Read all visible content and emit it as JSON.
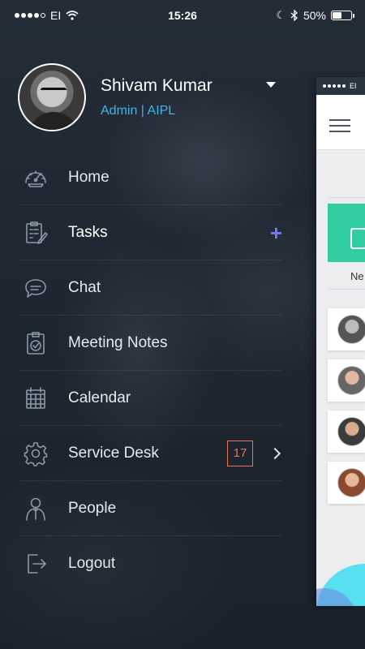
{
  "status_bar": {
    "carrier": "EI",
    "time": "15:26",
    "battery": "50%"
  },
  "profile": {
    "name": "Shivam Kumar",
    "role": "Admin | AIPL"
  },
  "menu": {
    "items": [
      {
        "label": "Home",
        "icon": "dashboard-gauge-icon"
      },
      {
        "label": "Tasks",
        "icon": "clipboard-pencil-icon",
        "action": "+"
      },
      {
        "label": "Chat",
        "icon": "chat-bubble-icon"
      },
      {
        "label": "Meeting Notes",
        "icon": "clipboard-check-icon"
      },
      {
        "label": "Calendar",
        "icon": "calendar-icon"
      },
      {
        "label": "Service Desk",
        "icon": "gear-icon",
        "badge": "17"
      },
      {
        "label": "People",
        "icon": "person-icon"
      },
      {
        "label": "Logout",
        "icon": "logout-icon"
      }
    ]
  },
  "preview": {
    "carrier": "EI",
    "new_label": "Ne"
  },
  "colors": {
    "background": "#1f2731",
    "role_text": "#42b4e6",
    "plus_accent": "#6e7df0",
    "badge_accent": "#e8745e",
    "card_green": "#2fcd9f"
  }
}
